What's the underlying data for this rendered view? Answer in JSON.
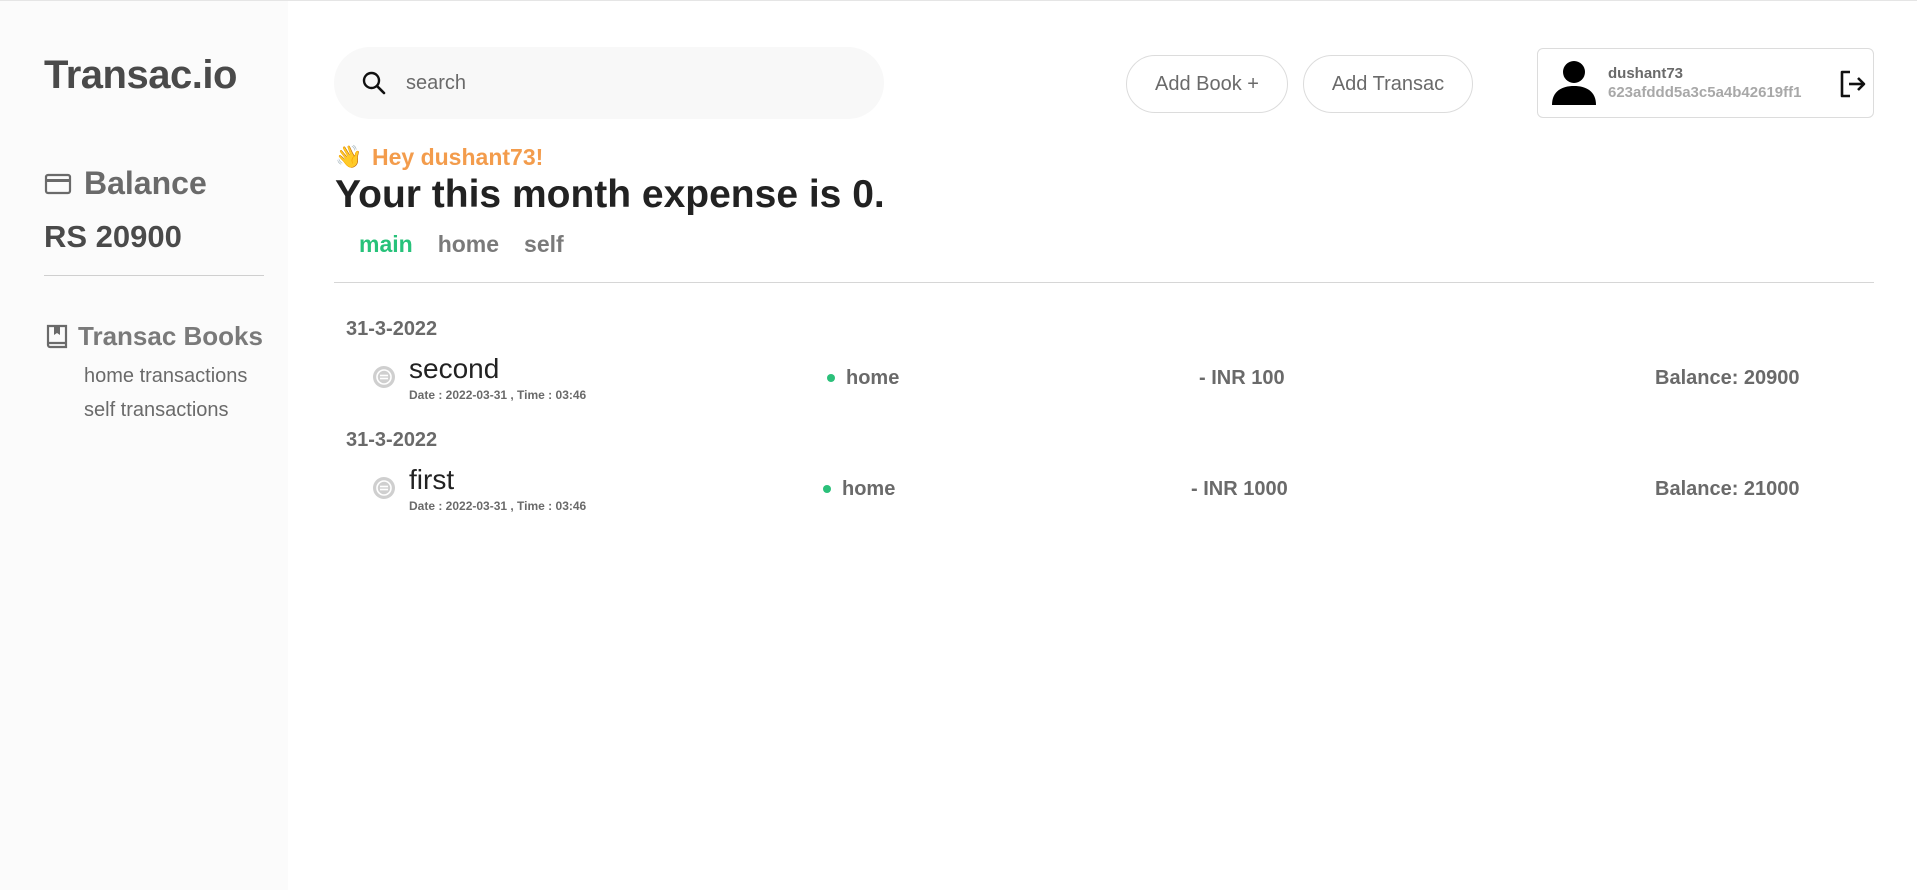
{
  "app": {
    "title": "Transac.io"
  },
  "sidebar": {
    "balance_label": "Balance",
    "balance_value": "RS 20900",
    "books_label": "Transac Books",
    "books": [
      {
        "label": "home transactions"
      },
      {
        "label": "self transactions"
      }
    ]
  },
  "search": {
    "placeholder": "search"
  },
  "toolbar": {
    "add_book_label": "Add Book +",
    "add_transac_label": "Add Transac"
  },
  "user": {
    "name": "dushant73",
    "id": "623afddd5a3c5a4b42619ff1"
  },
  "greeting": {
    "emoji": "👋",
    "hello": "Hey dushant73!",
    "headline": "Your this month expense is 0."
  },
  "tabs": [
    {
      "label": "main",
      "active": true
    },
    {
      "label": "home",
      "active": false
    },
    {
      "label": "self",
      "active": false
    }
  ],
  "transactions": [
    {
      "date": "31-3-2022",
      "title": "second",
      "meta": "Date : 2022-03-31 , Time : 03:46",
      "book": "home",
      "amount": "- INR 100",
      "balance": "Balance: 20900"
    },
    {
      "date": "31-3-2022",
      "title": "first",
      "meta": "Date : 2022-03-31 , Time : 03:46",
      "book": "home",
      "amount": "- INR 1000",
      "balance": "Balance: 21000"
    }
  ],
  "colors": {
    "accent_green": "#27c27a",
    "accent_orange": "#f39c4c",
    "sidebar_bg": "#fbfbfb"
  }
}
